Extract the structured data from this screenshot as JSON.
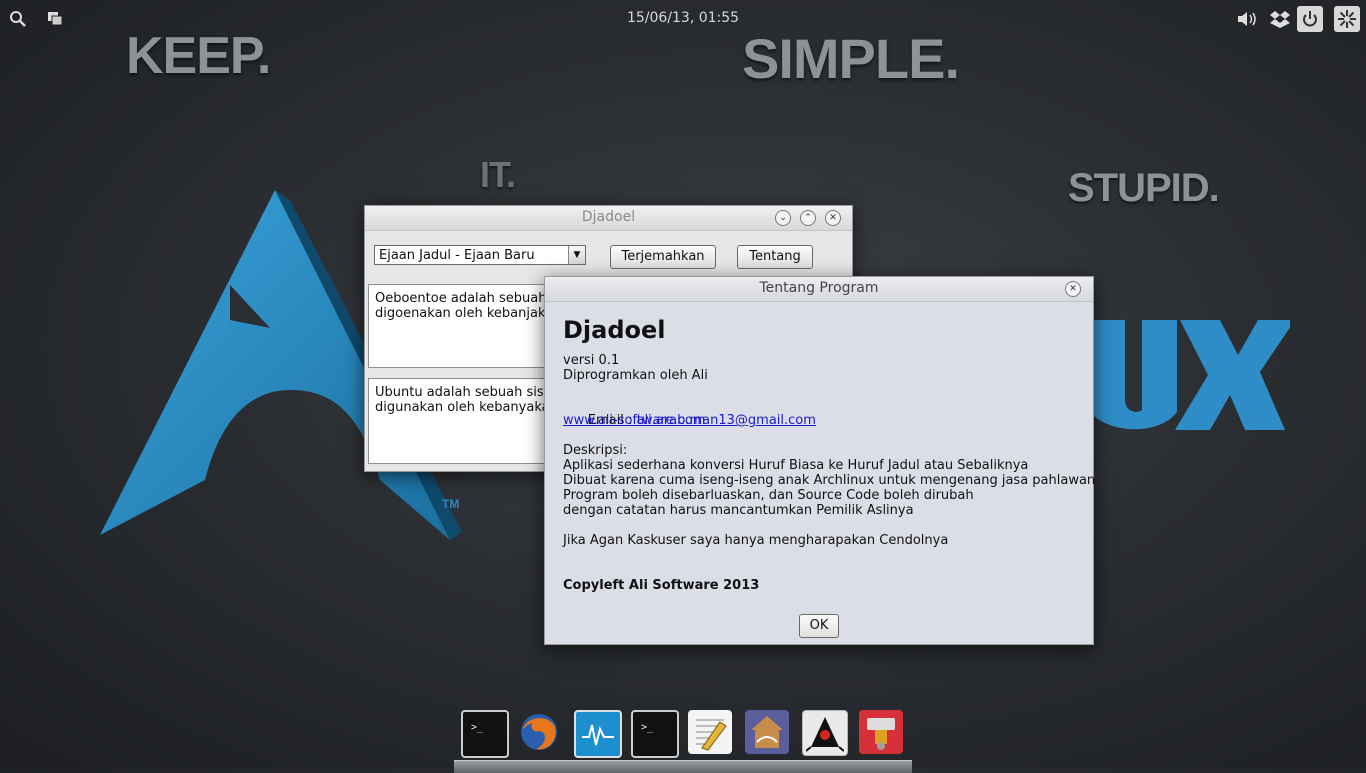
{
  "topbar": {
    "clock": "15/06/13, 01:55",
    "icons": [
      "search-icon",
      "windows-icon",
      "volume-icon",
      "dropbox-icon",
      "power-icon",
      "settings-icon"
    ]
  },
  "wallpaper": {
    "words": [
      "KEEP.",
      "IT.",
      "SIMPLE.",
      "STUPID."
    ],
    "brand_tm": "TM"
  },
  "main_window": {
    "title": "Djadoel",
    "combo_value": "Ejaan Jadul - Ejaan Baru",
    "translate_button": "Terjemahkan",
    "about_button": "Tentang",
    "input_text": "Oeboentoe adalah sebuah sistem operasi berbasis Linoex jang moedah \ndigoenakan oleh kebanjakan",
    "output_text": "Ubuntu adalah sebuah sistem\ndigunakan oleh kebanyakan"
  },
  "about_dialog": {
    "title": "Tentang Program",
    "app_name": "Djadoel",
    "version": "versi 0.1",
    "author": "Diprogramkan oleh Ali",
    "email_label": "Email : ",
    "email": "ali.arab.man13@gmail.com",
    "website": "www.ali-software.com",
    "desc_label": "Deskripsi:",
    "desc_lines": [
      "Aplikasi sederhana konversi Huruf Biasa ke Huruf Jadul atau Sebaliknya",
      "Dibuat karena cuma iseng-iseng anak Archlinux untuk mengenang jasa pahlawan",
      "Program boleh disebarluaskan, dan Source Code boleh dirubah",
      "dengan catatan harus mancantumkan Pemilik Aslinya"
    ],
    "kaskus_line": "Jika Agan Kaskuser saya hanya mengharapakan Cendolnya",
    "copyleft": "Copyleft Ali Software 2013",
    "ok_button": "OK"
  },
  "dock": {
    "items": [
      "terminal-icon",
      "firefox-icon",
      "system-monitor-icon",
      "terminal-icon",
      "text-editor-icon",
      "arabic-app-icon",
      "java-duke-icon",
      "package-manager-icon"
    ]
  }
}
